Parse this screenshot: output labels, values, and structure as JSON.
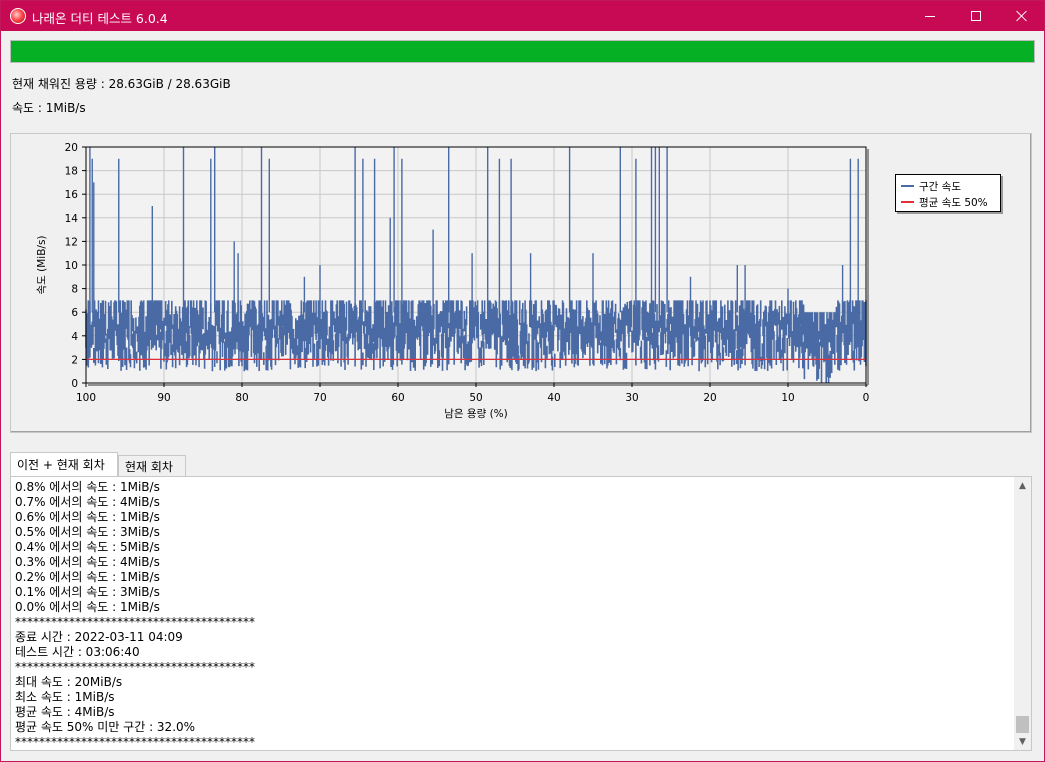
{
  "window": {
    "title": "나래온 더티 테스트 6.0.4",
    "app_icon": "app-logo-icon",
    "minimize_icon": "minimize-icon",
    "maximize_icon": "maximize-icon",
    "close_icon": "close-icon",
    "titlebar_color": "#c80a55"
  },
  "progress": {
    "value": 1.0,
    "color": "#06b025"
  },
  "status": {
    "capacity": "현재 채워진 용량 : 28.63GiB / 28.63GiB",
    "speed": "속도 : 1MiB/s"
  },
  "chart_data": {
    "type": "line",
    "xlabel": "남은 용량 (%)",
    "ylabel": "속도 (MiB/s)",
    "xlim": [
      100,
      0
    ],
    "ylim": [
      0,
      20
    ],
    "x_ticks": [
      "100",
      "90",
      "80",
      "70",
      "60",
      "50",
      "40",
      "30",
      "20",
      "10",
      "0"
    ],
    "y_ticks": [
      "0",
      "2",
      "4",
      "6",
      "8",
      "10",
      "12",
      "14",
      "16",
      "18",
      "20"
    ],
    "grid": true,
    "legend_position": "right",
    "series": [
      {
        "name": "구간 속도",
        "color": "#4a6aa5",
        "typical_range": [
          1,
          7
        ],
        "peaks": [
          {
            "x": 99.5,
            "y": 20
          },
          {
            "x": 99.2,
            "y": 19
          },
          {
            "x": 99,
            "y": 17
          },
          {
            "x": 95.8,
            "y": 19
          },
          {
            "x": 91.5,
            "y": 15
          },
          {
            "x": 87.5,
            "y": 20
          },
          {
            "x": 84,
            "y": 19
          },
          {
            "x": 83.5,
            "y": 20
          },
          {
            "x": 81,
            "y": 12
          },
          {
            "x": 80.5,
            "y": 11
          },
          {
            "x": 77.5,
            "y": 20
          },
          {
            "x": 76.5,
            "y": 19
          },
          {
            "x": 72,
            "y": 9
          },
          {
            "x": 70,
            "y": 10
          },
          {
            "x": 65.5,
            "y": 20
          },
          {
            "x": 64.5,
            "y": 19
          },
          {
            "x": 63,
            "y": 19
          },
          {
            "x": 61,
            "y": 14
          },
          {
            "x": 60.5,
            "y": 20
          },
          {
            "x": 59.5,
            "y": 19
          },
          {
            "x": 55.5,
            "y": 13
          },
          {
            "x": 53.5,
            "y": 20
          },
          {
            "x": 50.5,
            "y": 11
          },
          {
            "x": 48.5,
            "y": 20
          },
          {
            "x": 47,
            "y": 19
          },
          {
            "x": 45.5,
            "y": 19
          },
          {
            "x": 43,
            "y": 11
          },
          {
            "x": 38,
            "y": 20
          },
          {
            "x": 35,
            "y": 11
          },
          {
            "x": 31.5,
            "y": 20
          },
          {
            "x": 29.5,
            "y": 19
          },
          {
            "x": 27.5,
            "y": 20
          },
          {
            "x": 27,
            "y": 20
          },
          {
            "x": 26.5,
            "y": 20
          },
          {
            "x": 25.5,
            "y": 20
          },
          {
            "x": 22.5,
            "y": 9
          },
          {
            "x": 16.5,
            "y": 10
          },
          {
            "x": 15.5,
            "y": 10
          },
          {
            "x": 10,
            "y": 8
          },
          {
            "x": 3,
            "y": 10
          },
          {
            "x": 2,
            "y": 19
          },
          {
            "x": 1,
            "y": 19
          }
        ]
      },
      {
        "name": "평균 속도 50%",
        "color": "#e0303a",
        "y_constant": 2
      }
    ]
  },
  "tabs": [
    {
      "label": "이전 + 현재 회차",
      "active": true
    },
    {
      "label": "현재 회차",
      "active": false
    }
  ],
  "log": {
    "lines": [
      "0.8% 에서의 속도 : 1MiB/s",
      "0.7% 에서의 속도 : 4MiB/s",
      "0.6% 에서의 속도 : 1MiB/s",
      "0.5% 에서의 속도 : 3MiB/s",
      "0.4% 에서의 속도 : 5MiB/s",
      "0.3% 에서의 속도 : 4MiB/s",
      "0.2% 에서의 속도 : 1MiB/s",
      "0.1% 에서의 속도 : 3MiB/s",
      "0.0% 에서의 속도 : 1MiB/s",
      "****************************************",
      "종료 시간 : 2022-03-11 04:09",
      "테스트 시간 : 03:06:40",
      "****************************************",
      "최대 속도 : 20MiB/s",
      "최소 속도 : 1MiB/s",
      "평균 속도 : 4MiB/s",
      "평균 속도 50% 미만 구간 : 32.0%",
      "****************************************"
    ],
    "scroll_up_icon": "scroll-up-icon",
    "scroll_down_icon": "scroll-down-icon"
  }
}
